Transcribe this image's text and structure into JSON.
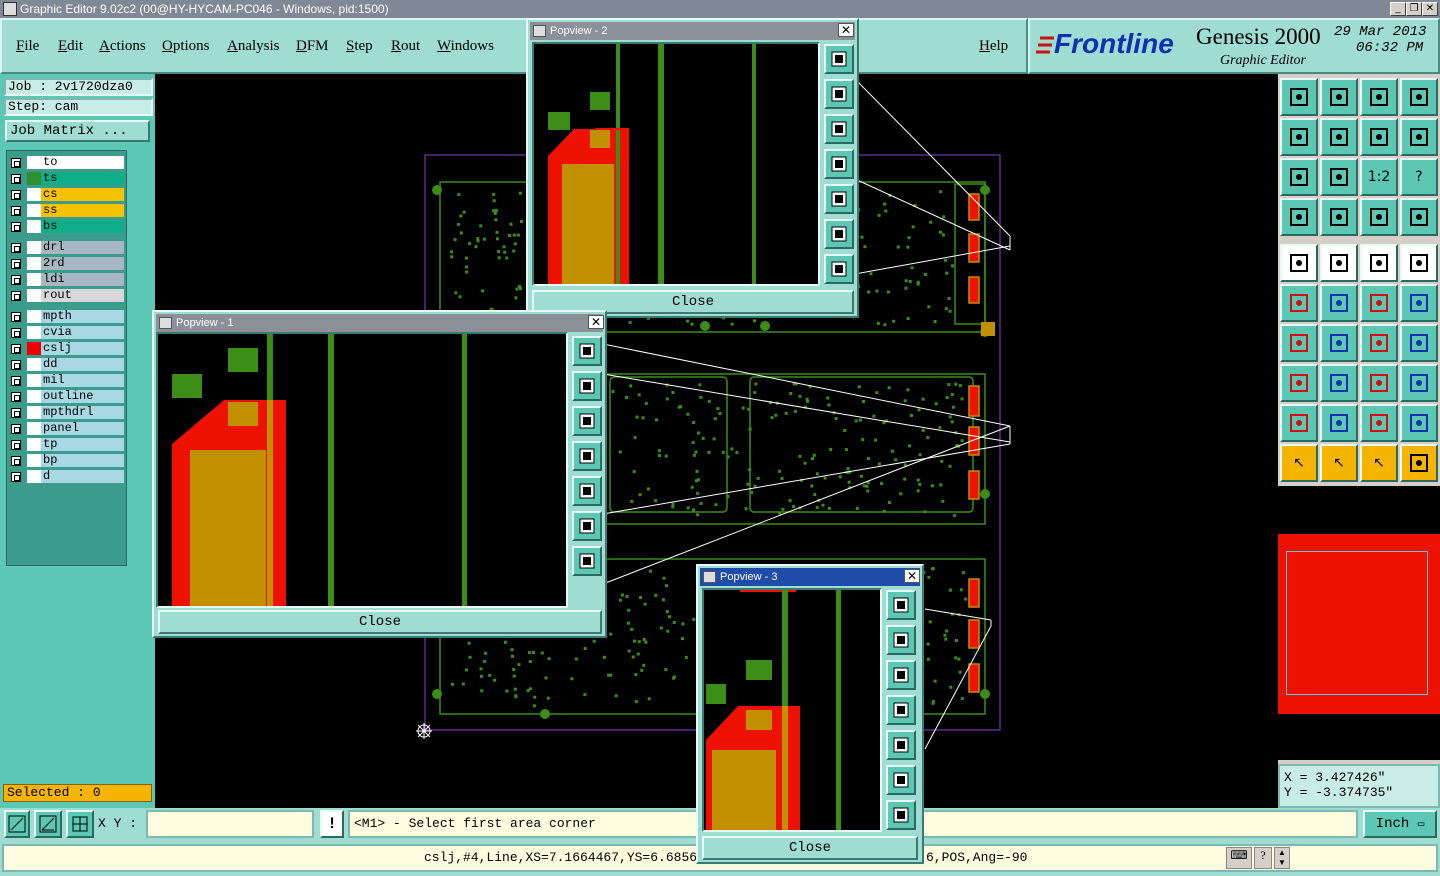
{
  "window": {
    "title": "Graphic Editor 9.02c2 (00@HY-HYCAM-PC046 - Windows, pid:1500)"
  },
  "menu": {
    "file": "File",
    "edit": "Edit",
    "actions": "Actions",
    "options": "Options",
    "analysis": "Analysis",
    "dfm": "DFM",
    "step": "Step",
    "rout": "Rout",
    "windows": "Windows",
    "help": "Help"
  },
  "brand": {
    "logo": "Frontline",
    "product": "Genesis 2000",
    "subtitle": "Graphic Editor",
    "date": "29 Mar 2013",
    "time": "06:32 PM"
  },
  "job": {
    "job_label": "Job : 2v1720dza0",
    "step_label": "Step: cam",
    "matrix_button": "Job Matrix ..."
  },
  "layers": [
    {
      "name": "to",
      "bg": "#ffffff",
      "swatch": "#ffffff"
    },
    {
      "name": "ts",
      "bg": "#0fae88",
      "swatch": "#2f8f2f"
    },
    {
      "name": "cs",
      "bg": "#f6c200",
      "swatch": "#ffffff"
    },
    {
      "name": "ss",
      "bg": "#f6c200",
      "swatch": "#ffffff"
    },
    {
      "name": "bs",
      "bg": "#0fae88",
      "swatch": "#ffffff"
    },
    {
      "name": "drl",
      "bg": "#a8b8c0",
      "swatch": "#ffffff"
    },
    {
      "name": "2rd",
      "bg": "#a8b8c0",
      "swatch": "#ffffff"
    },
    {
      "name": "ldi",
      "bg": "#a8b8c0",
      "swatch": "#ffffff"
    },
    {
      "name": "rout",
      "bg": "#d8d8d8",
      "swatch": "#ffffff"
    },
    {
      "name": "mpth",
      "bg": "#a8d8e4",
      "swatch": "#ffffff"
    },
    {
      "name": "cvia",
      "bg": "#a8d8e4",
      "swatch": "#ffffff"
    },
    {
      "name": "cslj",
      "bg": "#a8d8e4",
      "swatch": "#ee0000"
    },
    {
      "name": "dd",
      "bg": "#a8d8e4",
      "swatch": "#ffffff"
    },
    {
      "name": "mil",
      "bg": "#a8d8e4",
      "swatch": "#ffffff"
    },
    {
      "name": "outline",
      "bg": "#a8d8e4",
      "swatch": "#ffffff"
    },
    {
      "name": "mpthdrl",
      "bg": "#a8d8e4",
      "swatch": "#ffffff"
    },
    {
      "name": "panel",
      "bg": "#a8d8e4",
      "swatch": "#ffffff"
    },
    {
      "name": "tp",
      "bg": "#a8d8e4",
      "swatch": "#ffffff"
    },
    {
      "name": "bp",
      "bg": "#a8d8e4",
      "swatch": "#ffffff"
    },
    {
      "name": "d",
      "bg": "#a8d8e4",
      "swatch": "#ffffff"
    }
  ],
  "selected": "Selected : 0",
  "popviews": {
    "p1": {
      "title": "Popview - 1",
      "close": "Close"
    },
    "p2": {
      "title": "Popview - 2",
      "close": "Close"
    },
    "p3": {
      "title": "Popview - 3",
      "close": "Close"
    }
  },
  "coords": {
    "x": "X =  3.427426\"",
    "y": "Y = -3.374735\""
  },
  "xy_label": "X Y :",
  "xy_value": "",
  "prompt": "<M1> - Select first area corner",
  "units": "Inch",
  "status_line": "cslj,#4,Line,XS=7.1664467,YS=6.6856031,",
  "status_tail": "6,POS,Ang=-90",
  "colors": {
    "teal": "#5cc8b4",
    "copper": "#c09000",
    "pad": "#ee1100",
    "trace": "#3c8c18"
  }
}
